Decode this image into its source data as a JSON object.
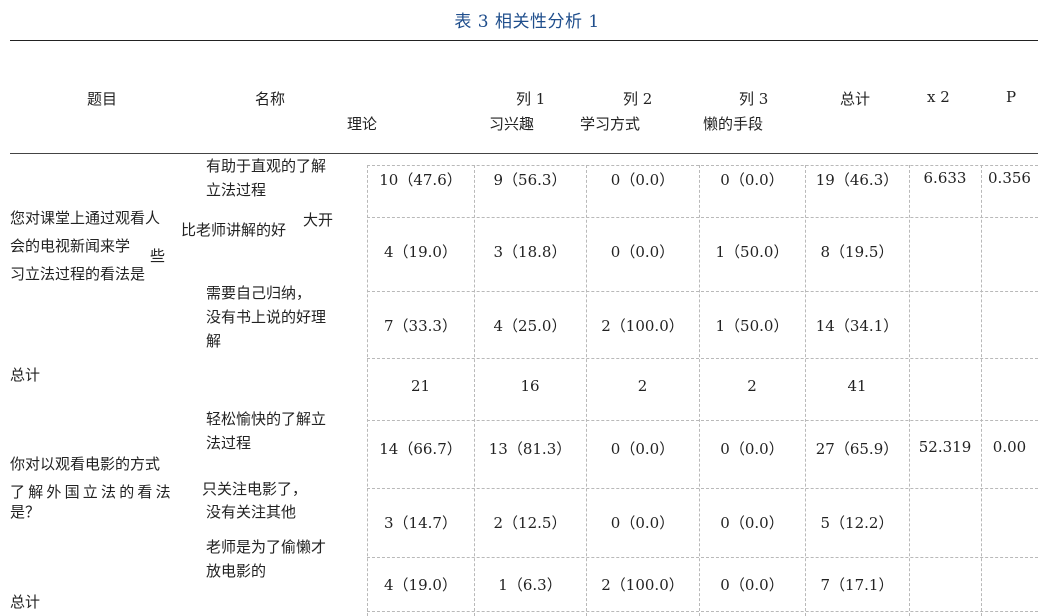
{
  "caption": "表 3   相关性分析 1",
  "header": {
    "col_topic": "题目",
    "col_name": "名称",
    "col_theory": "理论",
    "col1_top": "列 1",
    "col1_bottom": "习兴趣",
    "col2_top": "列 2",
    "col2_bottom": "学习方式",
    "col3_top": "列 3",
    "col3_bottom": "懒的手段",
    "col_total": "总计",
    "col_chi": "x 2",
    "col_p": "P"
  },
  "section1": {
    "question_lines": [
      "您对课堂上通过观看人",
      "会的电视新闻来学",
      "习立法过程的看法是"
    ],
    "question_fragment_xie": "些",
    "option_fragment_dakai": "大开",
    "options": [
      {
        "lines": [
          "有助于直观的了解",
          "立法过程"
        ],
        "values": [
          "10（47.6）",
          "9（56.3）",
          "0（0.0）",
          "0（0.0）",
          "19（46.3）"
        ],
        "chi": "6.633",
        "p": "0.356"
      },
      {
        "lines": [
          "比老师讲解的好"
        ],
        "values": [
          "4（19.0）",
          "3（18.8）",
          "0（0.0）",
          "1（50.0）",
          "8（19.5）"
        ],
        "chi": "",
        "p": ""
      },
      {
        "lines": [
          "需要自己归纳，",
          "没有书上说的好理",
          "解"
        ],
        "values": [
          "7（33.3）",
          "4（25.0）",
          "2（100.0）",
          "1（50.0）",
          "14（34.1）"
        ],
        "chi": "",
        "p": ""
      }
    ],
    "total_label": "总计",
    "totals": [
      "21",
      "16",
      "2",
      "2",
      "41"
    ]
  },
  "section2": {
    "question_lines": [
      "你对以观看电影的方式",
      "了解外国立法的看法",
      "是？"
    ],
    "options": [
      {
        "lines": [
          "轻松愉快的了解立",
          "法过程"
        ],
        "values": [
          "14（66.7）",
          "13（81.3）",
          "0（0.0）",
          "0（0.0）",
          "27（65.9）"
        ],
        "chi": "52.319",
        "p": "0.00"
      },
      {
        "lines": [
          "只关注电影了，",
          "没有关注其他"
        ],
        "values": [
          "3（14.7）",
          "2（12.5）",
          "0（0.0）",
          "0（0.0）",
          "5（12.2）"
        ],
        "chi": "",
        "p": ""
      },
      {
        "lines": [
          "老师是为了偷懒才",
          "放电影的"
        ],
        "values": [
          "4（19.0）",
          "1（6.3）",
          "2（100.0）",
          "0（0.0）",
          "7（17.1）"
        ],
        "chi": "",
        "p": ""
      }
    ],
    "total_label": "总计"
  }
}
